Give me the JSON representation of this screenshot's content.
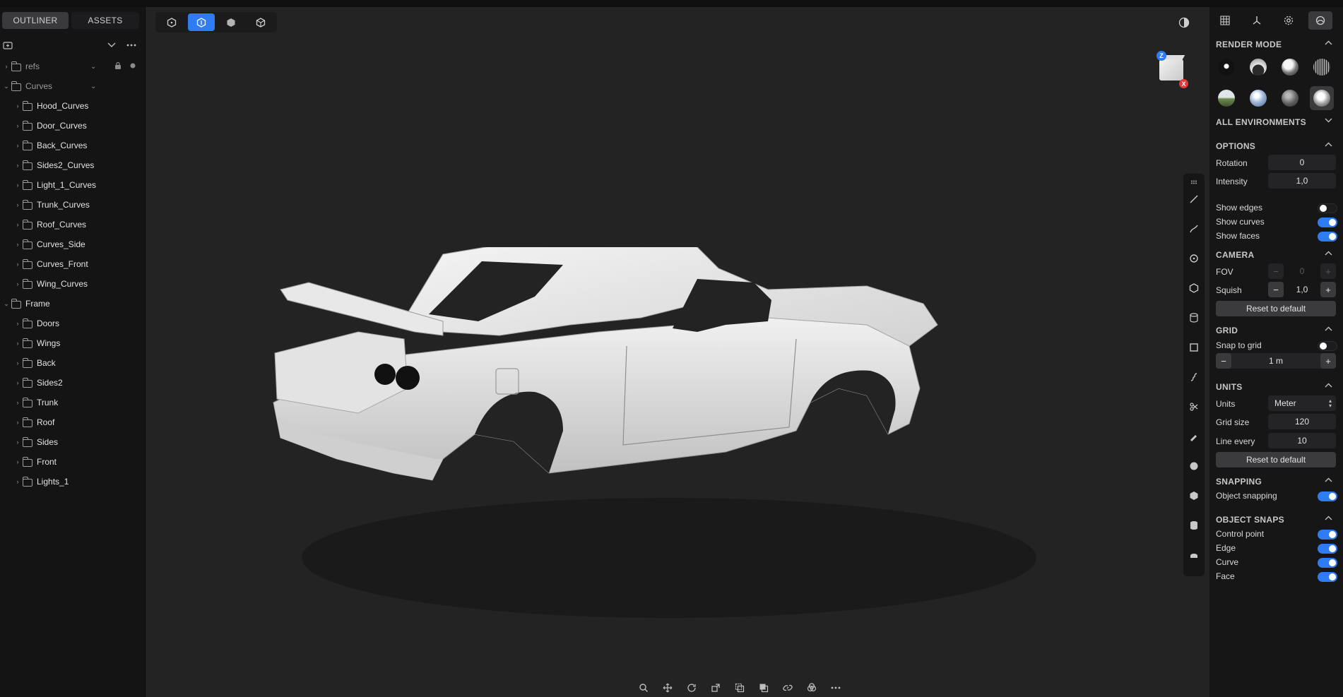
{
  "sidebar": {
    "tabs": [
      {
        "label": "OUTLINER"
      },
      {
        "label": "ASSETS"
      }
    ],
    "tree": [
      {
        "label": "refs",
        "level": 0,
        "expanded": false,
        "dim": true
      },
      {
        "label": "Curves",
        "level": 0,
        "expanded": true,
        "dim": true
      },
      {
        "label": "Hood_Curves",
        "level": 1,
        "expanded": false
      },
      {
        "label": "Door_Curves",
        "level": 1,
        "expanded": false
      },
      {
        "label": "Back_Curves",
        "level": 1,
        "expanded": false
      },
      {
        "label": "Sides2_Curves",
        "level": 1,
        "expanded": false
      },
      {
        "label": "Light_1_Curves",
        "level": 1,
        "expanded": false
      },
      {
        "label": "Trunk_Curves",
        "level": 1,
        "expanded": false
      },
      {
        "label": "Roof_Curves",
        "level": 1,
        "expanded": false
      },
      {
        "label": "Curves_Side",
        "level": 1,
        "expanded": false
      },
      {
        "label": "Curves_Front",
        "level": 1,
        "expanded": false
      },
      {
        "label": "Wing_Curves",
        "level": 1,
        "expanded": false
      },
      {
        "label": "Frame",
        "level": 0,
        "expanded": true
      },
      {
        "label": "Doors",
        "level": 1,
        "expanded": false
      },
      {
        "label": "Wings",
        "level": 1,
        "expanded": false
      },
      {
        "label": "Back",
        "level": 1,
        "expanded": false
      },
      {
        "label": "Sides2",
        "level": 1,
        "expanded": false
      },
      {
        "label": "Trunk",
        "level": 1,
        "expanded": false
      },
      {
        "label": "Roof",
        "level": 1,
        "expanded": false
      },
      {
        "label": "Sides",
        "level": 1,
        "expanded": false
      },
      {
        "label": "Front",
        "level": 1,
        "expanded": false
      },
      {
        "label": "Lights_1",
        "level": 1,
        "expanded": false
      }
    ]
  },
  "viewport": {
    "top_tools": [
      "select-icon",
      "edit-icon",
      "object-icon",
      "cube-icon"
    ],
    "active_tool": 1,
    "navcube": {
      "z_label": "Z",
      "x_label": "X"
    },
    "side_tools": [
      "line-icon",
      "curve-icon",
      "circle-icon",
      "polygon-icon",
      "loft-icon",
      "surface-icon",
      "spline-icon",
      "trim-icon",
      "brush-icon",
      "sphere-icon",
      "box-icon",
      "cylinder-icon",
      "mesh-icon"
    ],
    "bottom_tools": [
      "zoom-icon",
      "move-icon",
      "rotate-icon",
      "scale-icon",
      "duplicate-icon",
      "layer-icon",
      "link-icon",
      "boolean-icon",
      "more-icon"
    ]
  },
  "panel": {
    "tabs": [
      "grid-icon",
      "axes-icon",
      "settings-icon",
      "render-icon"
    ],
    "active_tab": 3,
    "render_mode": {
      "title": "RENDER MODE",
      "balls": [
        {
          "style": "radial-gradient(circle at 50% 45%, #ffffff 0 3px, #111 4px 100%)"
        },
        {
          "style": "radial-gradient(circle at 50% 70%, #2b2b2b 0 40%, #eaeaea 41%, #888 100%)"
        },
        {
          "style": "radial-gradient(circle at 40% 35%, #f5f5f5 0 30%, #777 55%, #222 100%)"
        },
        {
          "style": "repeating-linear-gradient(90deg, #bbb 0 1px, #444 1px 3px)"
        },
        {
          "style": "linear-gradient(180deg, #dfe6ea 0 45%, #6c8a4c 55%, #3f4f2e 100%)"
        },
        {
          "style": "radial-gradient(circle at 40% 35%, #ffffff 0 15%, #9fb8d8 45%, #4a6488 100%)"
        },
        {
          "style": "radial-gradient(circle at 40% 35%, #b9b9b9 0 15%, #5d5d5d 55%, #2a2a2a 100%)"
        },
        {
          "style": "radial-gradient(circle at 45% 40%, #ffffff 0 25%, #aaa 50%, #333 100%)"
        }
      ],
      "active_ball": 7
    },
    "environments_title": "ALL ENVIRONMENTS",
    "options": {
      "title": "OPTIONS",
      "rotation_label": "Rotation",
      "rotation_value": "0",
      "intensity_label": "Intensity",
      "intensity_value": "1,0",
      "show_edges_label": "Show edges",
      "show_edges": false,
      "show_curves_label": "Show curves",
      "show_curves": true,
      "show_faces_label": "Show faces",
      "show_faces": true
    },
    "camera": {
      "title": "CAMERA",
      "fov_label": "FOV",
      "fov_value": "0",
      "squish_label": "Squish",
      "squish_value": "1,0",
      "reset_label": "Reset to default"
    },
    "grid": {
      "title": "GRID",
      "snap_label": "Snap to grid",
      "snap": false,
      "size_value": "1 m"
    },
    "units": {
      "title": "UNITS",
      "units_label": "Units",
      "units_value": "Meter",
      "grid_size_label": "Grid size",
      "grid_size_value": "120",
      "line_every_label": "Line every",
      "line_every_value": "10",
      "reset_label": "Reset to default"
    },
    "snapping": {
      "title": "SNAPPING",
      "object_snapping_label": "Object snapping",
      "object_snapping": true
    },
    "object_snaps": {
      "title": "OBJECT SNAPS",
      "items": [
        {
          "label": "Control point",
          "on": true
        },
        {
          "label": "Edge",
          "on": true
        },
        {
          "label": "Curve",
          "on": true
        },
        {
          "label": "Face",
          "on": true
        }
      ]
    }
  }
}
